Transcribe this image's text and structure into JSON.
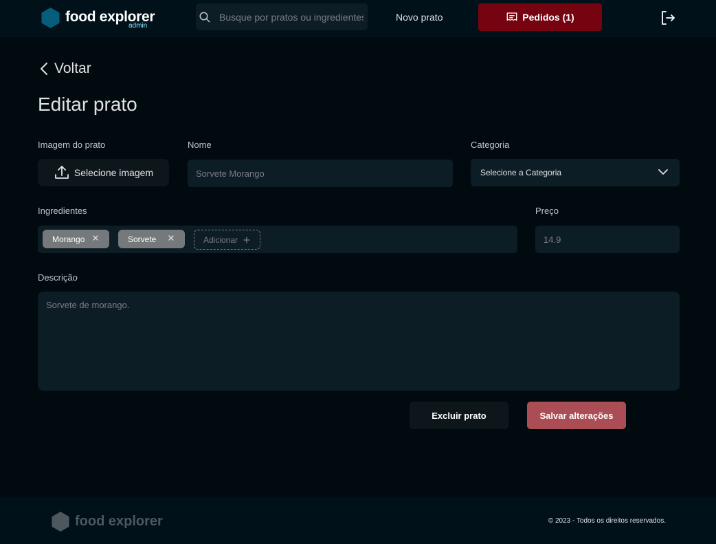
{
  "header": {
    "logo_text": "food explorer",
    "logo_badge": "admin",
    "search_placeholder": "Busque por pratos ou ingredientes",
    "new_dish_link": "Novo prato",
    "orders_button": "Pedidos (1)",
    "icons": {
      "search": "search-icon",
      "orders": "receipt-icon",
      "logout": "sign-out-icon"
    }
  },
  "page": {
    "back_label": "Voltar",
    "title": "Editar prato"
  },
  "form": {
    "image_label": "Imagem do prato",
    "image_button": "Selecione imagem",
    "name_label": "Nome",
    "name_value": "Sorvete Morango",
    "category_label": "Categoria",
    "category_value": "Selecione a Categoria",
    "ingredients_label": "Ingredientes",
    "ingredients": [
      {
        "label": "Morango"
      },
      {
        "label": "Sorvete"
      }
    ],
    "add_ingredient": "Adicionar",
    "price_label": "Preço",
    "price_value": "14.9",
    "description_label": "Descrição",
    "description_value": "Sorvete de morango.",
    "delete_button": "Excluir prato",
    "save_button": "Salvar alterações"
  },
  "footer": {
    "logo_text": "food explorer",
    "copyright": "© 2023 - Todos os direitos reservados."
  },
  "colors": {
    "background": "#000a0f",
    "header_bg": "#00111a",
    "input_bg": "#0d1d25",
    "orders_button": "#750310",
    "save_button": "#ab4d55",
    "logo_hex": "#065e7c",
    "admin_badge": "#82f3ff",
    "tag_bg": "#76797b"
  }
}
